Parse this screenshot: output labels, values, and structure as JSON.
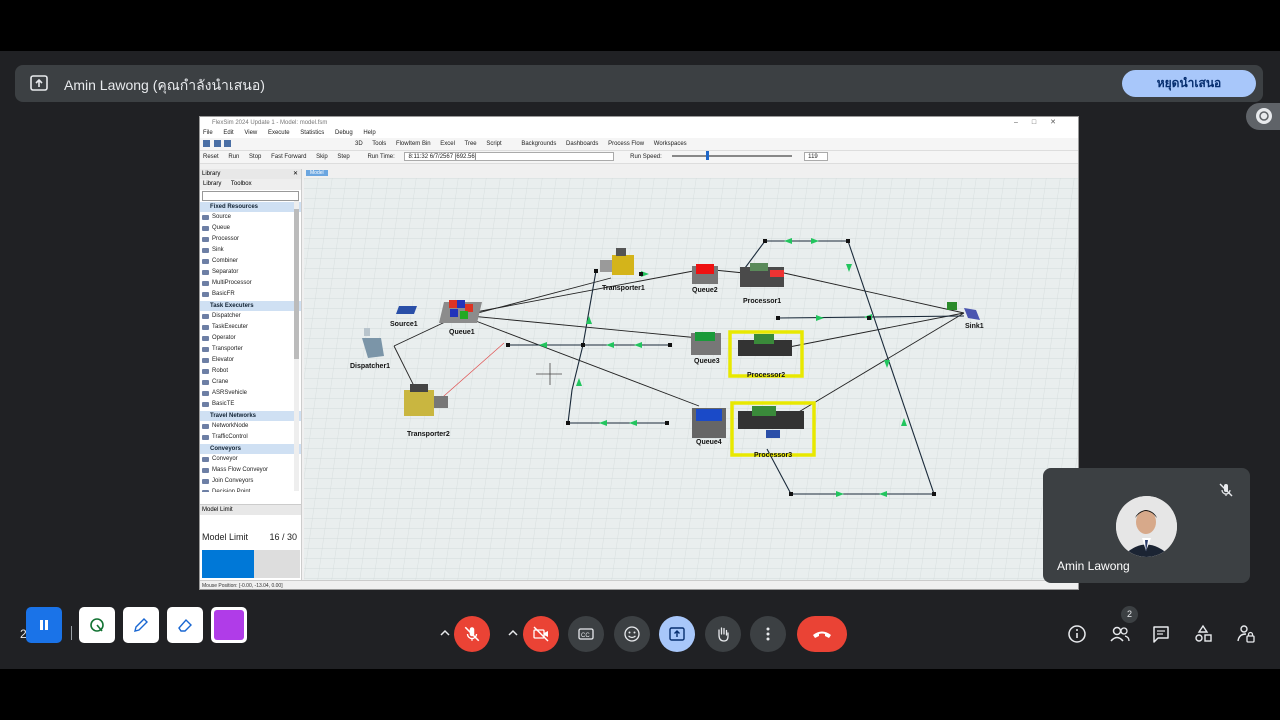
{
  "meeting": {
    "presenter_banner": "Amin Lawong (คุณกำลังนำเสนอ)",
    "stop_presenting_label": "หยุดนำเสนอ",
    "self_name": "Amin Lawong",
    "participants_count": "2",
    "clipped_left_text": "2"
  },
  "flexsim": {
    "window_title": "FlexSim 2024 Update 1 - Model: model.fsm",
    "menu": [
      "File",
      "Edit",
      "View",
      "Execute",
      "Statistics",
      "Debug",
      "Help"
    ],
    "toolbar": [
      "3D",
      "Tools",
      "FlowItem Bin",
      "Excel",
      "Tree",
      "Script",
      "Backgrounds",
      "Dashboards",
      "Process Flow",
      "Workspaces"
    ],
    "run_bar": {
      "reset": "Reset",
      "run": "Run",
      "stop": "Stop",
      "fast_forward": "Fast Forward",
      "skip": "Skip",
      "step": "Step",
      "run_time_label": "Run Time:",
      "run_time_value": "8:11:32  6/7/2567  [692.56]",
      "run_speed_label": "Run Speed:",
      "run_speed_value": "119"
    },
    "library": {
      "title": "Library",
      "tabs": [
        "Library",
        "Toolbox"
      ],
      "categories": [
        {
          "name": "Fixed Resources",
          "items": [
            "Source",
            "Queue",
            "Processor",
            "Sink",
            "Combiner",
            "Separator",
            "MultiProcessor",
            "BasicFR"
          ]
        },
        {
          "name": "Task Executers",
          "items": [
            "Dispatcher",
            "TaskExecuter",
            "Operator",
            "Transporter",
            "Elevator",
            "Robot",
            "Crane",
            "ASRSvehicle",
            "BasicTE"
          ]
        },
        {
          "name": "Travel Networks",
          "items": [
            "NetworkNode",
            "TrafficControl"
          ]
        },
        {
          "name": "Conveyors",
          "items": [
            "Conveyor",
            "Mass Flow Conveyor",
            "Join Conveyors",
            "Decision Point"
          ]
        }
      ]
    },
    "model_limit": {
      "panel_title": "Model Limit",
      "label": "Model Limit",
      "value_text": "16 / 30",
      "used": 16,
      "max": 30
    },
    "model_tab": "Model",
    "status_bar": "Mouse Position: [-0.00, -13.04, 0.00]",
    "objects": [
      "Source1",
      "Queue1",
      "Dispatcher1",
      "Transporter1",
      "Transporter2",
      "Queue2",
      "Queue3",
      "Queue4",
      "Processor1",
      "Processor2",
      "Processor3",
      "Sink1"
    ]
  },
  "colors": {
    "hangup": "#ea4335",
    "accent": "#a8c7fa",
    "banner": "#3c4043",
    "processor_highlight": "#e8e800",
    "path_arrow": "#22c55e"
  }
}
